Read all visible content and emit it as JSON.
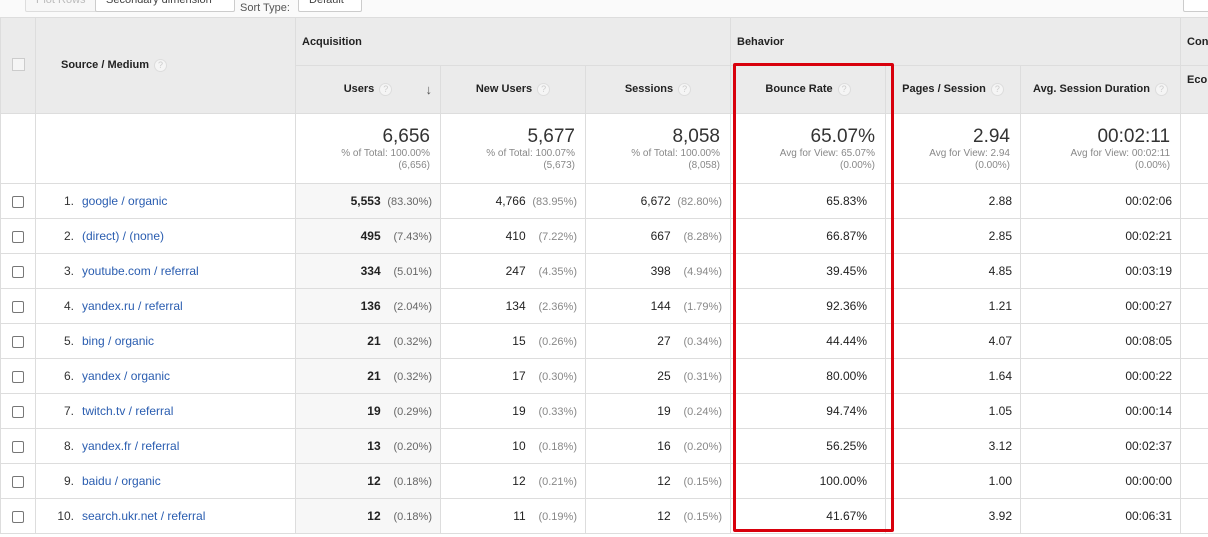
{
  "toolbar": {
    "plot_rows": "Plot Rows",
    "secondary_dimension": "Secondary dimension",
    "sort_type_label": "Sort Type:",
    "sort_type_value": "Default"
  },
  "headers": {
    "source_medium": "Source / Medium",
    "acquisition": "Acquisition",
    "behavior": "Behavior",
    "conversions": "Conv",
    "users": "Users",
    "new_users": "New Users",
    "sessions": "Sessions",
    "bounce_rate": "Bounce Rate",
    "pages_session": "Pages / Session",
    "avg_session_duration": "Avg. Session Duration",
    "ecommerce": "Eco",
    "help": "?",
    "sort_arrow": "↓"
  },
  "totals": {
    "users": {
      "value": "6,656",
      "line1": "% of Total: 100.00%",
      "line2": "(6,656)"
    },
    "new_users": {
      "value": "5,677",
      "line1": "% of Total: 100.07%",
      "line2": "(5,673)"
    },
    "sessions": {
      "value": "8,058",
      "line1": "% of Total: 100.00%",
      "line2": "(8,058)"
    },
    "bounce_rate": {
      "value": "65.07%",
      "line1": "Avg for View: 65.07%",
      "line2": "(0.00%)"
    },
    "pages_session": {
      "value": "2.94",
      "line1": "Avg for View: 2.94",
      "line2": "(0.00%)"
    },
    "avg_session_duration": {
      "value": "00:02:11",
      "line1": "Avg for View: 00:02:11",
      "line2": "(0.00%)"
    }
  },
  "rows": [
    {
      "n": "1.",
      "source": "google / organic",
      "users": "5,553",
      "users_pct": "(83.30%)",
      "new_users": "4,766",
      "new_users_pct": "(83.95%)",
      "sessions": "6,672",
      "sessions_pct": "(82.80%)",
      "bounce": "65.83%",
      "pages": "2.88",
      "duration": "00:02:06"
    },
    {
      "n": "2.",
      "source": "(direct) / (none)",
      "users": "495",
      "users_pct": "(7.43%)",
      "new_users": "410",
      "new_users_pct": "(7.22%)",
      "sessions": "667",
      "sessions_pct": "(8.28%)",
      "bounce": "66.87%",
      "pages": "2.85",
      "duration": "00:02:21"
    },
    {
      "n": "3.",
      "source": "youtube.com / referral",
      "users": "334",
      "users_pct": "(5.01%)",
      "new_users": "247",
      "new_users_pct": "(4.35%)",
      "sessions": "398",
      "sessions_pct": "(4.94%)",
      "bounce": "39.45%",
      "pages": "4.85",
      "duration": "00:03:19"
    },
    {
      "n": "4.",
      "source": "yandex.ru / referral",
      "users": "136",
      "users_pct": "(2.04%)",
      "new_users": "134",
      "new_users_pct": "(2.36%)",
      "sessions": "144",
      "sessions_pct": "(1.79%)",
      "bounce": "92.36%",
      "pages": "1.21",
      "duration": "00:00:27"
    },
    {
      "n": "5.",
      "source": "bing / organic",
      "users": "21",
      "users_pct": "(0.32%)",
      "new_users": "15",
      "new_users_pct": "(0.26%)",
      "sessions": "27",
      "sessions_pct": "(0.34%)",
      "bounce": "44.44%",
      "pages": "4.07",
      "duration": "00:08:05"
    },
    {
      "n": "6.",
      "source": "yandex / organic",
      "users": "21",
      "users_pct": "(0.32%)",
      "new_users": "17",
      "new_users_pct": "(0.30%)",
      "sessions": "25",
      "sessions_pct": "(0.31%)",
      "bounce": "80.00%",
      "pages": "1.64",
      "duration": "00:00:22"
    },
    {
      "n": "7.",
      "source": "twitch.tv / referral",
      "users": "19",
      "users_pct": "(0.29%)",
      "new_users": "19",
      "new_users_pct": "(0.33%)",
      "sessions": "19",
      "sessions_pct": "(0.24%)",
      "bounce": "94.74%",
      "pages": "1.05",
      "duration": "00:00:14"
    },
    {
      "n": "8.",
      "source": "yandex.fr / referral",
      "users": "13",
      "users_pct": "(0.20%)",
      "new_users": "10",
      "new_users_pct": "(0.18%)",
      "sessions": "16",
      "sessions_pct": "(0.20%)",
      "bounce": "56.25%",
      "pages": "3.12",
      "duration": "00:02:37"
    },
    {
      "n": "9.",
      "source": "baidu / organic",
      "users": "12",
      "users_pct": "(0.18%)",
      "new_users": "12",
      "new_users_pct": "(0.21%)",
      "sessions": "12",
      "sessions_pct": "(0.15%)",
      "bounce": "100.00%",
      "pages": "1.00",
      "duration": "00:00:00"
    },
    {
      "n": "10.",
      "source": "search.ukr.net / referral",
      "users": "12",
      "users_pct": "(0.18%)",
      "new_users": "11",
      "new_users_pct": "(0.19%)",
      "sessions": "12",
      "sessions_pct": "(0.15%)",
      "bounce": "41.67%",
      "pages": "3.92",
      "duration": "00:06:31"
    }
  ],
  "colors": {
    "highlight": "#d8000c",
    "link": "#2a5db0",
    "header_bg": "#ebebeb"
  }
}
